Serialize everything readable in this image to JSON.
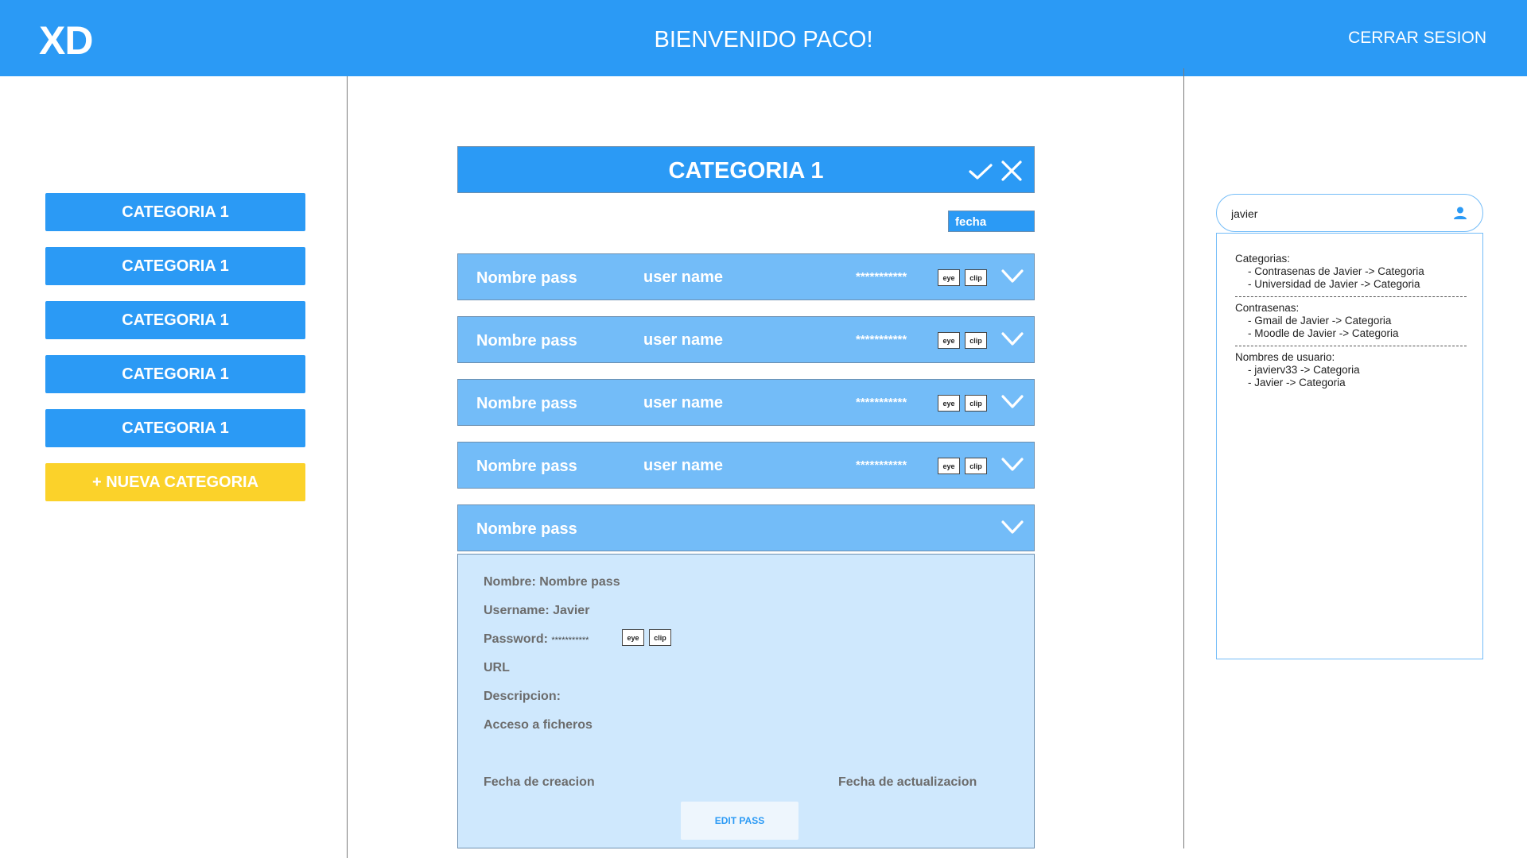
{
  "header": {
    "logo": "XD",
    "welcome": "BIENVENIDO PACO!",
    "logout": "CERRAR SESION"
  },
  "sidebar": {
    "categories": [
      "CATEGORIA 1",
      "CATEGORIA 1",
      "CATEGORIA 1",
      "CATEGORIA 1",
      "CATEGORIA 1"
    ],
    "new_category": "+ NUEVA CATEGORIA"
  },
  "main": {
    "category_title": "CATEGORIA 1",
    "sort_label": "fecha",
    "rows": [
      {
        "name": "Nombre pass",
        "user": "user name",
        "password": "***********",
        "eye": "eye",
        "clip": "clip"
      },
      {
        "name": "Nombre pass",
        "user": "user name",
        "password": "***********",
        "eye": "eye",
        "clip": "clip"
      },
      {
        "name": "Nombre pass",
        "user": "user name",
        "password": "***********",
        "eye": "eye",
        "clip": "clip"
      },
      {
        "name": "Nombre pass",
        "user": "user name",
        "password": "***********",
        "eye": "eye",
        "clip": "clip"
      }
    ],
    "expanded": {
      "name": "Nombre pass",
      "nombre": "Nombre: Nombre pass",
      "username": "Username: Javier",
      "password_label": "Password:",
      "password_value": "***********",
      "eye": "eye",
      "clip": "clip",
      "url": "URL",
      "descripcion": "Descripcion:",
      "acceso": "Acceso a ficheros",
      "fecha_creacion": "Fecha de creacion",
      "fecha_actualizacion": "Fecha de actualizacion",
      "edit_button": "EDIT PASS"
    }
  },
  "search": {
    "value": "javier",
    "icon": "user-icon",
    "results": {
      "categorias_label": "Categorias:",
      "categorias": [
        "- Contrasenas de Javier -> Categoria",
        "- Universidad de Javier -> Categoria"
      ],
      "contrasenas_label": "Contrasenas:",
      "contrasenas": [
        "- Gmail de Javier -> Categoria",
        "- Moodle de Javier -> Categoria"
      ],
      "usuarios_label": "Nombres de usuario:",
      "usuarios": [
        "- javierv33 -> Categoria",
        "- Javier -> Categoria"
      ]
    }
  },
  "colors": {
    "primary": "#2b9af5",
    "row": "#73bcf8",
    "detail": "#cfe8fd",
    "accent_yellow": "#fbd22a"
  }
}
